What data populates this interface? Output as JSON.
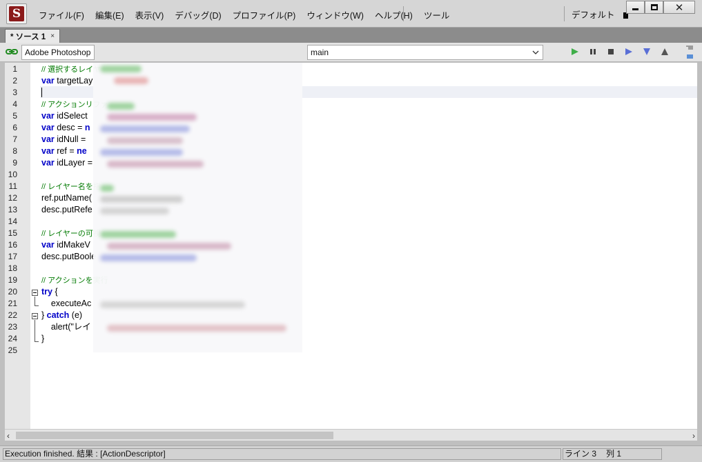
{
  "app": {
    "icon": "extendscript-toolkit-logo"
  },
  "menu": [
    "ファイル(F)",
    "編集(E)",
    "表示(V)",
    "デバッグ(D)",
    "プロファイル(P)",
    "ウィンドウ(W)",
    "ヘルプ(H)",
    "ツール"
  ],
  "layout": {
    "label": "デフォルト"
  },
  "window_controls": {
    "close": "✕"
  },
  "tab": {
    "label": "* ソース 1",
    "close": "×"
  },
  "toolbar": {
    "target_app": "Adobe Photoshop",
    "engine": "main",
    "buttons": [
      "run-icon",
      "pause-icon",
      "stop-icon",
      "step-over-icon",
      "step-into-icon",
      "step-out-icon"
    ]
  },
  "editor": {
    "lines": [
      {
        "n": "1",
        "segs": [
          {
            "t": "// 選択するレイヤ",
            "c": "cm"
          }
        ]
      },
      {
        "n": "2",
        "segs": [
          {
            "t": "var",
            "c": "kw"
          },
          {
            "t": " targetLay",
            "c": ""
          }
        ]
      },
      {
        "n": "3",
        "segs": []
      },
      {
        "n": "4",
        "segs": [
          {
            "t": "// アクションリファ",
            "c": "cm"
          }
        ]
      },
      {
        "n": "5",
        "segs": [
          {
            "t": "var",
            "c": "kw"
          },
          {
            "t": " idSelect",
            "c": ""
          }
        ]
      },
      {
        "n": "6",
        "segs": [
          {
            "t": "var",
            "c": "kw"
          },
          {
            "t": " desc = ",
            "c": ""
          },
          {
            "t": "n",
            "c": "kw"
          }
        ]
      },
      {
        "n": "7",
        "segs": [
          {
            "t": "var",
            "c": "kw"
          },
          {
            "t": " idNull = ",
            "c": ""
          }
        ]
      },
      {
        "n": "8",
        "segs": [
          {
            "t": "var",
            "c": "kw"
          },
          {
            "t": " ref = ",
            "c": ""
          },
          {
            "t": "ne",
            "c": "kw"
          }
        ]
      },
      {
        "n": "9",
        "segs": [
          {
            "t": "var",
            "c": "kw"
          },
          {
            "t": " idLayer =",
            "c": ""
          }
        ]
      },
      {
        "n": "10",
        "segs": []
      },
      {
        "n": "11",
        "segs": [
          {
            "t": "// レイヤー名を指",
            "c": "cm"
          }
        ]
      },
      {
        "n": "12",
        "segs": [
          {
            "t": "ref.putName(",
            "c": ""
          }
        ]
      },
      {
        "n": "13",
        "segs": [
          {
            "t": "desc.putRefe",
            "c": ""
          }
        ]
      },
      {
        "n": "14",
        "segs": []
      },
      {
        "n": "15",
        "segs": [
          {
            "t": "// レイヤーの可視",
            "c": "cm"
          }
        ]
      },
      {
        "n": "16",
        "segs": [
          {
            "t": "var",
            "c": "kw"
          },
          {
            "t": " idMakeV",
            "c": ""
          }
        ]
      },
      {
        "n": "17",
        "segs": [
          {
            "t": "desc.putBoole",
            "c": ""
          }
        ]
      },
      {
        "n": "18",
        "segs": []
      },
      {
        "n": "19",
        "segs": [
          {
            "t": "// アクションを実行",
            "c": "cm"
          }
        ]
      },
      {
        "n": "20",
        "segs": [
          {
            "t": "try",
            "c": "kw"
          },
          {
            "t": " {",
            "c": ""
          }
        ]
      },
      {
        "n": "21",
        "segs": [
          {
            "t": "    executeAc",
            "c": ""
          }
        ]
      },
      {
        "n": "22",
        "segs": [
          {
            "t": "} ",
            "c": ""
          },
          {
            "t": "catch",
            "c": "kw"
          },
          {
            "t": " (e)",
            "c": ""
          }
        ]
      },
      {
        "n": "23",
        "segs": [
          {
            "t": "    alert(\"レイ",
            "c": ""
          }
        ]
      },
      {
        "n": "24",
        "segs": [
          {
            "t": "}",
            "c": ""
          }
        ]
      },
      {
        "n": "25",
        "segs": []
      }
    ]
  },
  "status": {
    "message": "Execution finished. 結果 : [ActionDescriptor]",
    "line": "ライン 3",
    "col": "列 1"
  }
}
